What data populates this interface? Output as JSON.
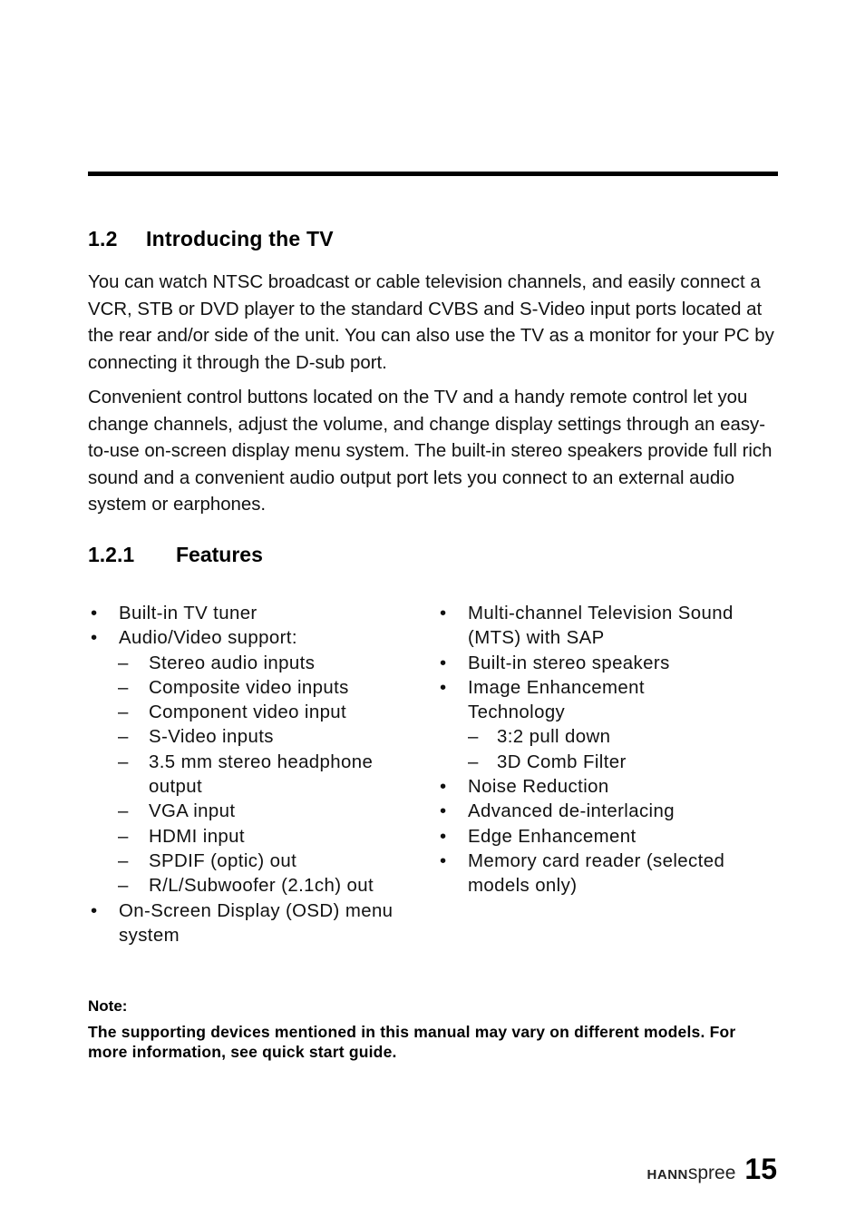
{
  "section": {
    "number": "1.2",
    "title": "Introducing the TV",
    "paragraphs": [
      "You can watch NTSC broadcast or cable television channels, and easily connect a VCR, STB or DVD player to the standard CVBS and S-Video input ports located at the rear and/or side of the unit. You can also use the TV as a monitor for your PC by connecting it through the D-sub port.",
      "Convenient control buttons located on the TV and a handy remote control let you change channels, adjust the volume, and change display settings through an easy-to-use on-screen display menu system. The built-in stereo speakers provide full rich sound and a convenient audio output port lets you connect to an external audio system or earphones."
    ]
  },
  "subsection": {
    "number": "1.2.1",
    "title": "Features"
  },
  "features": {
    "bullet_marker": "•",
    "dash_marker": "–",
    "left": [
      {
        "text": "Built-in TV tuner"
      },
      {
        "text": "Audio/Video support:"
      },
      {
        "text": "Stereo audio inputs"
      },
      {
        "text": "Composite video inputs"
      },
      {
        "text": "Component video input"
      },
      {
        "text": "S-Video inputs"
      },
      {
        "text": "3.5 mm stereo headphone output"
      },
      {
        "text": "VGA input"
      },
      {
        "text": "HDMI input"
      },
      {
        "text": "SPDIF (optic) out"
      },
      {
        "text": "R/L/Subwoofer (2.1ch) out"
      },
      {
        "text": "On-Screen Display (OSD) menu system"
      }
    ],
    "right": [
      {
        "text": "Multi-channel Television Sound (MTS) with SAP"
      },
      {
        "text": "Built-in stereo speakers"
      },
      {
        "text": "Image Enhancement Technology"
      },
      {
        "text": "3:2 pull down"
      },
      {
        "text": "3D Comb Filter"
      },
      {
        "text": "Noise Reduction"
      },
      {
        "text": "Advanced de-interlacing"
      },
      {
        "text": "Edge Enhancement"
      },
      {
        "text": "Memory card reader (selected models only)"
      }
    ]
  },
  "note": {
    "label": "Note:",
    "text": "The supporting devices mentioned in this manual may vary on different models. For more information, see quick start guide."
  },
  "footer": {
    "brand_bold": "HANN",
    "brand_light": "spree",
    "page_number": "15"
  }
}
